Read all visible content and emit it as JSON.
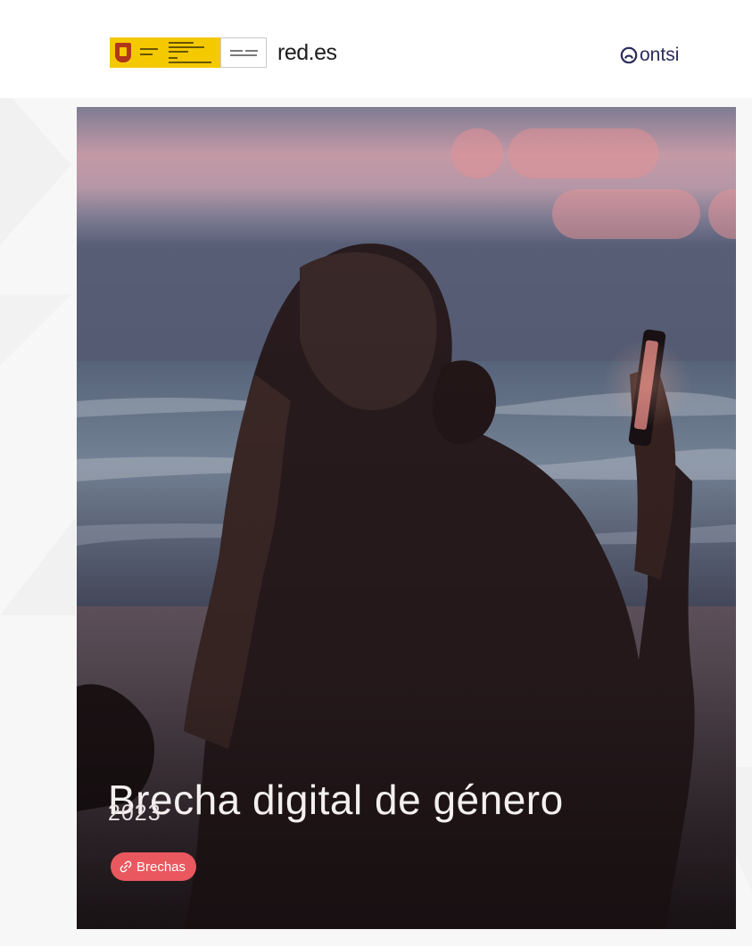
{
  "header": {
    "gov_logo_icon": "government-of-spain-logo-icon",
    "partner_name": "red.es",
    "ontsi_icon": "ontsi-logo-icon",
    "ontsi_name": "ontsi"
  },
  "cover": {
    "photo_icon": "woman-holding-phone-at-beach-photo",
    "title": "Brecha digital de género",
    "year": "2023",
    "badge": {
      "icon": "link-icon",
      "label": "Brechas",
      "color": "#e9585e"
    }
  },
  "colors": {
    "accent": "#e9585e",
    "pill_pink": "#e19196",
    "background": "#f7f7f7"
  }
}
